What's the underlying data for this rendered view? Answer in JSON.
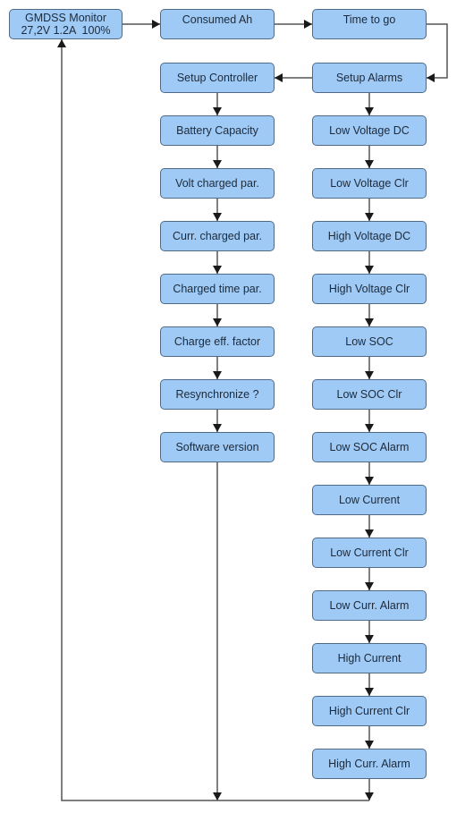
{
  "diagram": {
    "type": "menu-flowchart",
    "colors": {
      "node_fill": "#9fcaf6",
      "node_border": "#4f6a86",
      "connector": "#555555",
      "background": "#ffffff"
    },
    "top_row": {
      "start": {
        "title": "GMDSS Monitor",
        "readout": "27,2V 1.2A  100%"
      },
      "consumed": "Consumed Ah",
      "time_to_go": "Time to go"
    },
    "setup_controller": {
      "title": "Setup Controller",
      "items": [
        "Battery Capacity",
        "Volt charged par.",
        "Curr. charged par.",
        "Charged time par.",
        "Charge eff. factor",
        "Resynchronize ?",
        "Software version"
      ]
    },
    "setup_alarms": {
      "title": "Setup Alarms",
      "items": [
        "Low Voltage DC",
        "Low Voltage Clr",
        "High Voltage DC",
        "High Voltage Clr",
        "Low SOC",
        "Low SOC Clr",
        "Low SOC Alarm",
        "Low Current",
        "Low Current Clr",
        "Low Curr. Alarm",
        "High Current",
        "High Current Clr",
        "High Curr. Alarm"
      ]
    },
    "edges": [
      [
        "GMDSS Monitor",
        "Consumed Ah"
      ],
      [
        "Consumed Ah",
        "Time to go"
      ],
      [
        "Time to go",
        "Setup Alarms"
      ],
      [
        "Setup Alarms",
        "Setup Controller"
      ],
      [
        "Setup Controller",
        "Battery Capacity"
      ],
      [
        "Software version",
        "GMDSS Monitor"
      ],
      [
        "Setup Alarms",
        "Low Voltage DC"
      ],
      [
        "High Curr. Alarm",
        "GMDSS Monitor"
      ]
    ]
  }
}
